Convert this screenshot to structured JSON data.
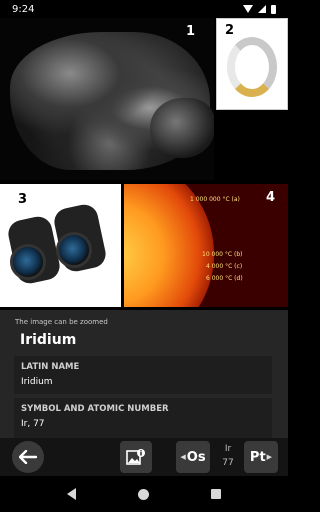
{
  "status": {
    "time": "9:24"
  },
  "photos": [
    {
      "number": "1"
    },
    {
      "number": "2"
    },
    {
      "number": "3"
    },
    {
      "number": "4"
    }
  ],
  "sun_annotations": [
    {
      "text": "1 000 000 °C  (a)"
    },
    {
      "text": "10 000 °C  (b)"
    },
    {
      "text": "4 000 °C  (c)"
    },
    {
      "text": "6 000 °C  (d)"
    }
  ],
  "panel": {
    "hint": "The image can be zoomed",
    "title": "Iridium",
    "rows": [
      {
        "label": "LATIN NAME",
        "value": "Iridium"
      },
      {
        "label": "SYMBOL AND ATOMIC NUMBER",
        "value": "Ir, 77"
      }
    ]
  },
  "toolbar": {
    "prev_symbol": "Os",
    "current_symbol": "Ir",
    "current_number": "77",
    "next_symbol": "Pt"
  },
  "colors": {
    "accent_sun": "#e24a0a",
    "panel_bg": "#262626"
  }
}
